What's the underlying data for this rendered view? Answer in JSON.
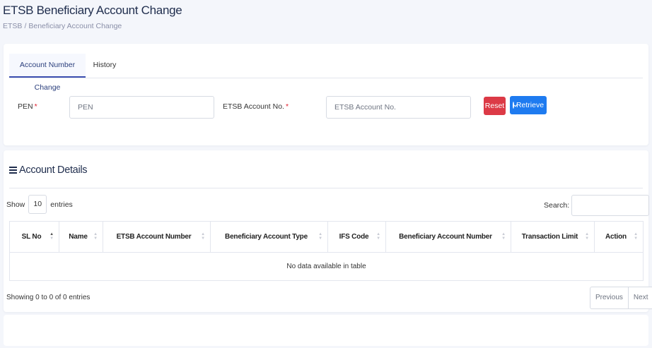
{
  "header": {
    "title": "ETSB Beneficiary Account Change",
    "breadcrumb": [
      "ETSB",
      "Beneficiary Account Change"
    ],
    "breadcrumb_separator": "/"
  },
  "tabs": [
    {
      "label": "Account Number Change",
      "active": true
    },
    {
      "label": "History",
      "active": false
    }
  ],
  "form": {
    "pen_label": "PEN",
    "pen_required": "*",
    "pen_placeholder": "PEN",
    "account_label": "ETSB Account No.",
    "account_required": "*",
    "account_placeholder": "ETSB Account No.",
    "reset_label": "Reset",
    "retrieve_label": "Retrieve"
  },
  "details": {
    "title": "Account Details",
    "show_label": "Show",
    "entries_value": "10",
    "entries_label": "entries",
    "search_label": "Search:",
    "columns": [
      "SL No",
      "Name",
      "ETSB Account Number",
      "Beneficiary Account Type",
      "IFS Code",
      "Beneficiary Account Number",
      "Transaction Limit",
      "Action"
    ],
    "empty_text": "No data available in table",
    "info_text": "Showing 0 to 0 of 0 entries",
    "prev_label": "Previous",
    "next_label": "Next"
  },
  "colors": {
    "reset": "#dc3a46",
    "retrieve": "#1e7bf0",
    "required": "#e0202e",
    "title": "#1f2d4d"
  }
}
